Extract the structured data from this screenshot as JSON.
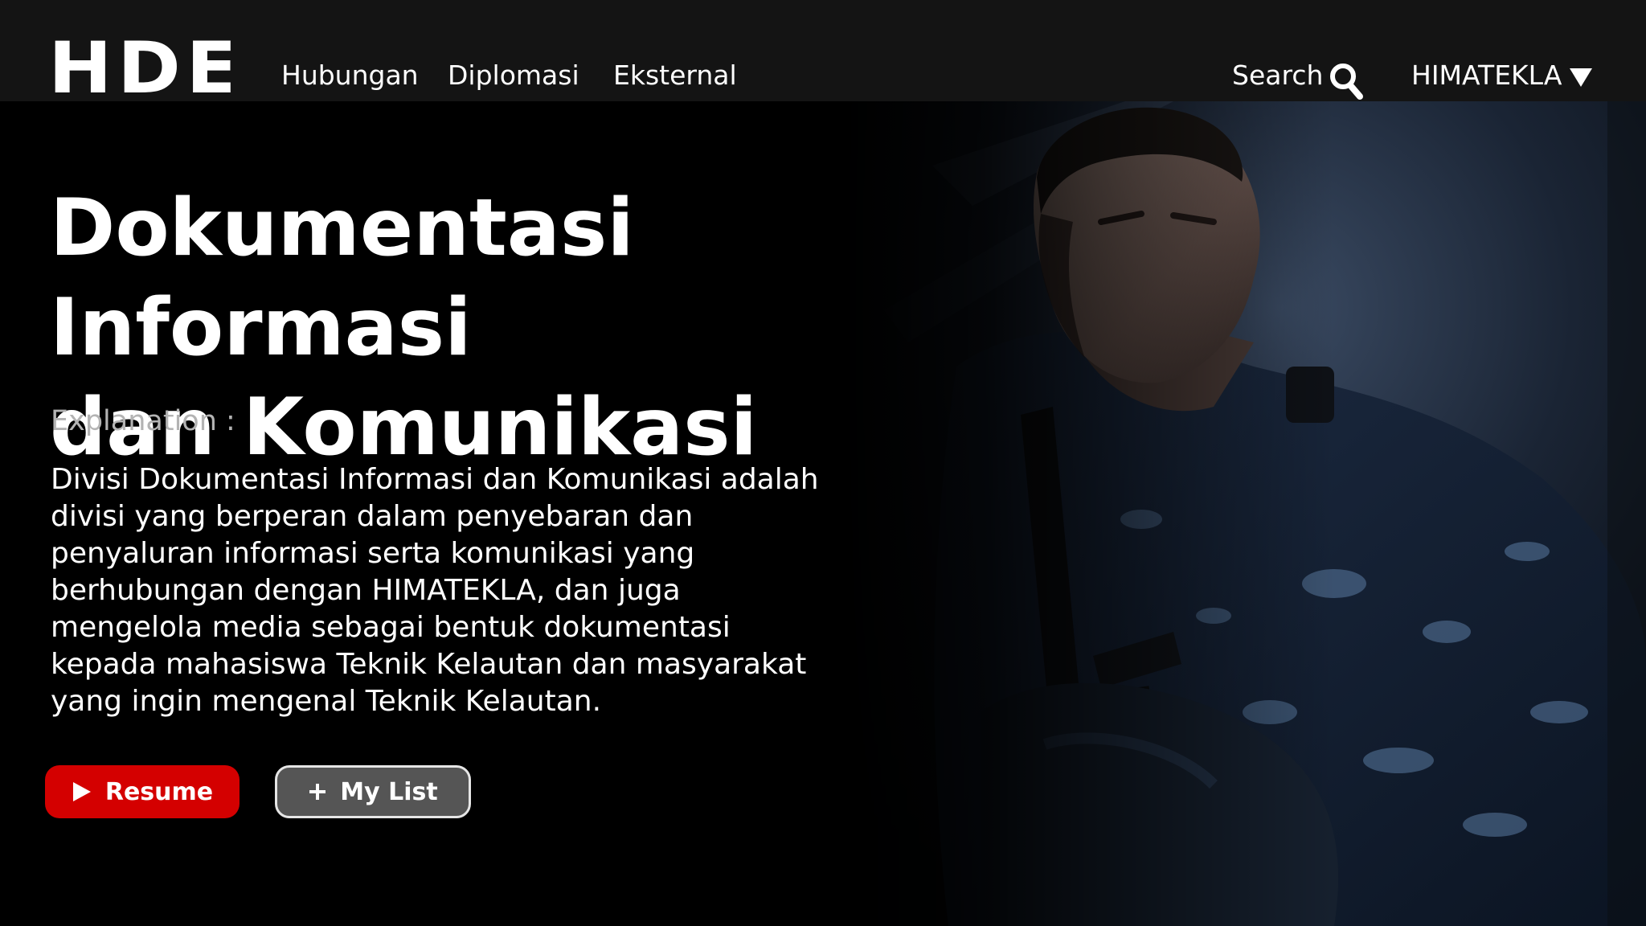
{
  "nav": {
    "logo_text": "HDE",
    "links": [
      {
        "label": "Hubungan"
      },
      {
        "label": "Diplomasi"
      },
      {
        "label": "Eksternal"
      }
    ],
    "search_label": "Search",
    "search_icon": "search-icon",
    "profile_label": "HIMATEKLA",
    "profile_icon": "caret-down-icon"
  },
  "hero": {
    "title_line1": "Dokumentasi Informasi",
    "title_line2": "dan Komunikasi",
    "explanation_label": "Explanation :",
    "body_lines": [
      "Divisi Dokumentasi Informasi dan Komunikasi adalah",
      "divisi yang berperan dalam penyebaran dan",
      "penyaluran informasi serta komunikasi yang",
      "berhubungan dengan HIMATEKLA, dan juga",
      "mengelola media sebagai bentuk dokumentasi",
      "kepada mahasiswa Teknik Kelautan dan masyarakat",
      "yang ingin mengenal Teknik Kelautan."
    ],
    "image_subject": "soldier in camouflage uniform holding a rifle"
  },
  "actions": {
    "resume_label": "Resume",
    "resume_icon": "play-icon",
    "mylist_label": "My List",
    "mylist_icon": "plus-icon"
  },
  "colors": {
    "navbar_bg": "#141414",
    "page_bg": "#000000",
    "resume_red": "#d40000",
    "mylist_gray": "#555555",
    "muted_text": "#b3b3b3"
  }
}
